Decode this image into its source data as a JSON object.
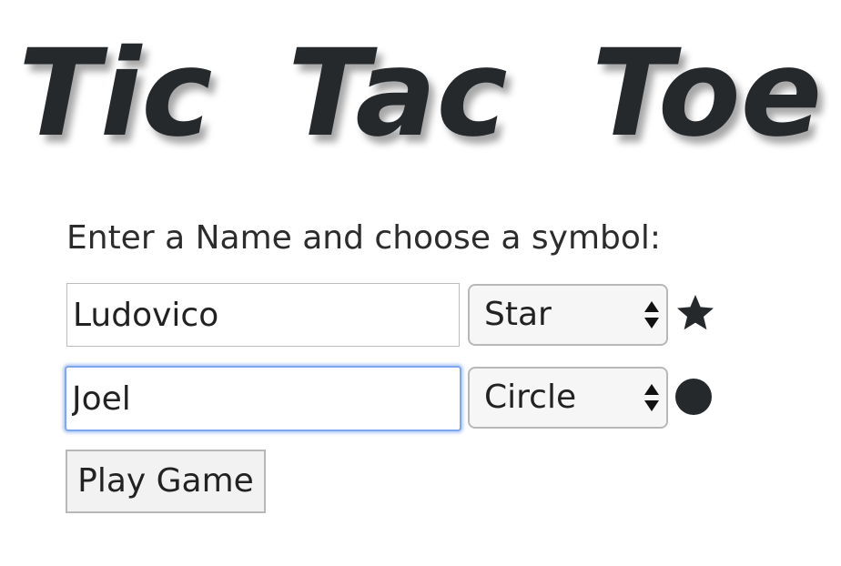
{
  "title": {
    "word1": "Tic",
    "word2": "Tac",
    "word3": "Toe"
  },
  "instruction": "Enter a Name and choose a symbol:",
  "players": [
    {
      "name": "Ludovico",
      "symbol": "Star",
      "symbol_icon": "star-icon",
      "focused": false
    },
    {
      "name": "Joel",
      "symbol": "Circle",
      "symbol_icon": "circle-icon",
      "focused": true
    }
  ],
  "play_button_label": "Play Game",
  "colors": {
    "title": "#25292c",
    "icon": "#25292c",
    "focus_ring": "#7fa7ef"
  }
}
